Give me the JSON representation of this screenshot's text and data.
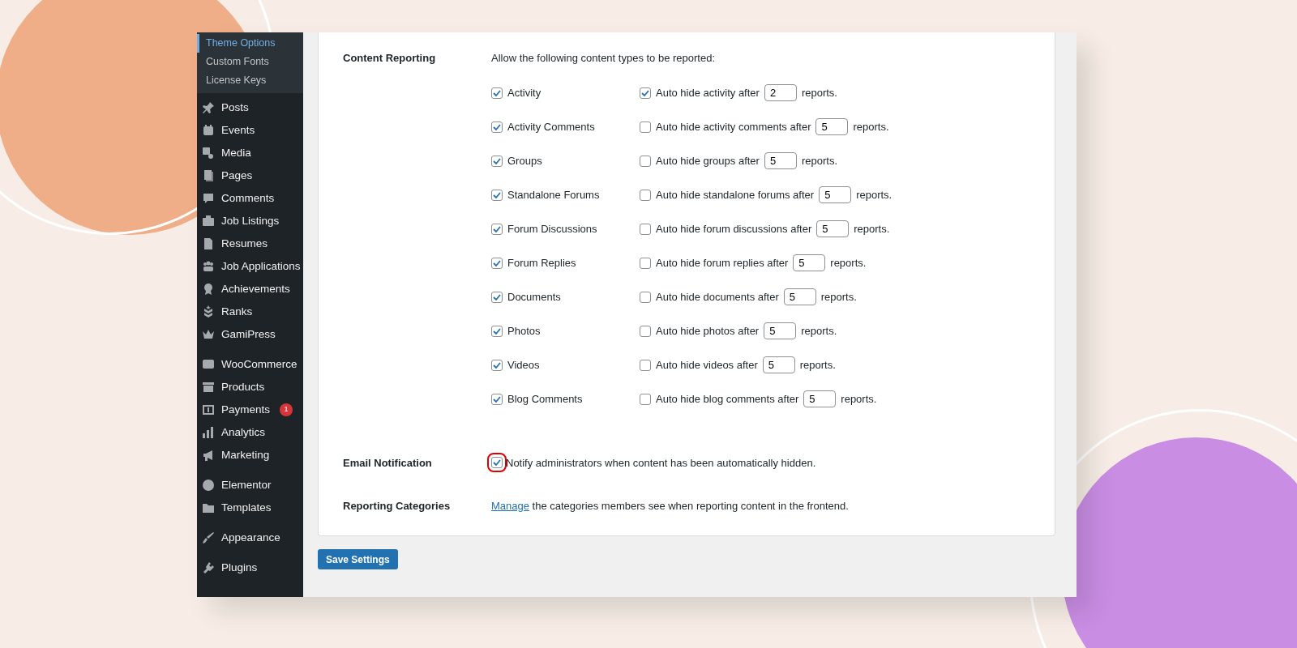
{
  "sidebar": {
    "submenu": [
      {
        "label": "Theme Options",
        "selected": true
      },
      {
        "label": "Custom Fonts",
        "selected": false
      },
      {
        "label": "License Keys",
        "selected": false
      }
    ],
    "groups": [
      [
        {
          "label": "Posts"
        },
        {
          "label": "Events"
        },
        {
          "label": "Media"
        },
        {
          "label": "Pages"
        },
        {
          "label": "Comments"
        },
        {
          "label": "Job Listings"
        },
        {
          "label": "Resumes"
        },
        {
          "label": "Job Applications"
        },
        {
          "label": "Achievements"
        },
        {
          "label": "Ranks"
        },
        {
          "label": "GamiPress"
        }
      ],
      [
        {
          "label": "WooCommerce"
        },
        {
          "label": "Products"
        },
        {
          "label": "Payments",
          "badge": "1"
        },
        {
          "label": "Analytics"
        },
        {
          "label": "Marketing"
        }
      ],
      [
        {
          "label": "Elementor"
        },
        {
          "label": "Templates"
        }
      ],
      [
        {
          "label": "Appearance"
        }
      ],
      [
        {
          "label": "Plugins"
        }
      ]
    ]
  },
  "settings": {
    "content_reporting": {
      "label": "Content Reporting",
      "intro": "Allow the following content types to be reported:",
      "rows": [
        {
          "label": "Activity",
          "checked": true,
          "auto_hide": {
            "checked": true,
            "before": "Auto hide activity after",
            "value": "2",
            "after": "reports."
          }
        },
        {
          "label": "Activity Comments",
          "checked": true,
          "auto_hide": {
            "checked": false,
            "before": "Auto hide activity comments after",
            "value": "5",
            "after": "reports."
          }
        },
        {
          "label": "Groups",
          "checked": true,
          "auto_hide": {
            "checked": false,
            "before": "Auto hide groups after",
            "value": "5",
            "after": "reports."
          }
        },
        {
          "label": "Standalone Forums",
          "checked": true,
          "auto_hide": {
            "checked": false,
            "before": "Auto hide standalone forums after",
            "value": "5",
            "after": "reports."
          }
        },
        {
          "label": "Forum Discussions",
          "checked": true,
          "auto_hide": {
            "checked": false,
            "before": "Auto hide forum discussions after",
            "value": "5",
            "after": "reports."
          }
        },
        {
          "label": "Forum Replies",
          "checked": true,
          "auto_hide": {
            "checked": false,
            "before": "Auto hide forum replies after",
            "value": "5",
            "after": "reports."
          }
        },
        {
          "label": "Documents",
          "checked": true,
          "auto_hide": {
            "checked": false,
            "before": "Auto hide documents after",
            "value": "5",
            "after": "reports."
          }
        },
        {
          "label": "Photos",
          "checked": true,
          "auto_hide": {
            "checked": false,
            "before": "Auto hide photos after",
            "value": "5",
            "after": "reports."
          }
        },
        {
          "label": "Videos",
          "checked": true,
          "auto_hide": {
            "checked": false,
            "before": "Auto hide videos after",
            "value": "5",
            "after": "reports."
          }
        },
        {
          "label": "Blog Comments",
          "checked": true,
          "auto_hide": {
            "checked": false,
            "before": "Auto hide blog comments after",
            "value": "5",
            "after": "reports."
          }
        }
      ]
    },
    "email_notification": {
      "label": "Email Notification",
      "checked": true,
      "highlighted": true,
      "text": "Notify administrators when content has been automatically hidden."
    },
    "reporting_categories": {
      "label": "Reporting Categories",
      "link": "Manage",
      "text": "the categories members see when reporting content in the frontend."
    }
  },
  "save_button": "Save Settings"
}
